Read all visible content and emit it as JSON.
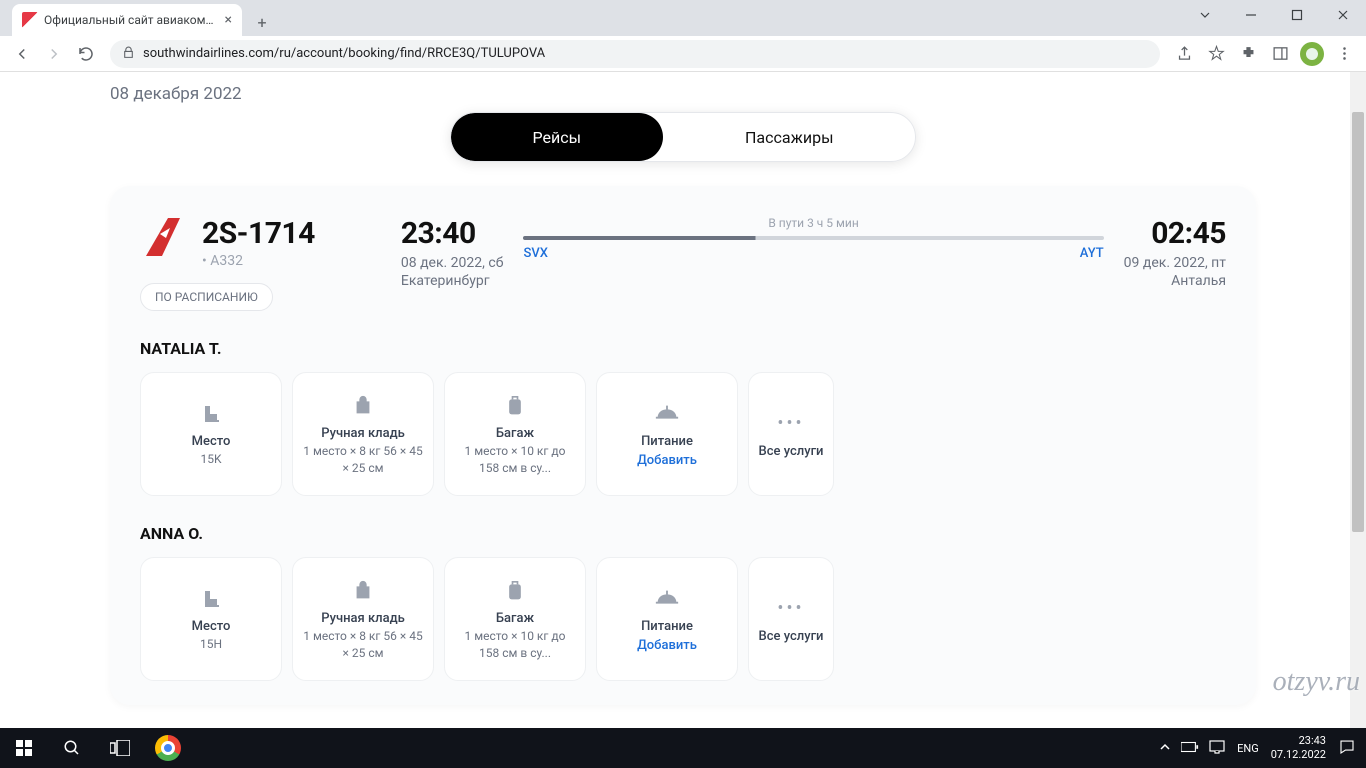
{
  "browser": {
    "tab_title": "Официальный сайт авиакомпан",
    "url": "southwindairlines.com/ru/account/booking/find/RRCE3Q/TULUPOVA"
  },
  "page": {
    "date_sub": "08 декабря 2022",
    "tabs": {
      "flights": "Рейсы",
      "passengers": "Пассажиры"
    }
  },
  "flight": {
    "number": "2S-1714",
    "aircraft": "A332",
    "status": "ПО РАСПИСАНИЮ",
    "duration": "В пути 3 ч 5 мин",
    "dep": {
      "time": "23:40",
      "date": "08 дек. 2022, сб",
      "city": "Екатеринбург",
      "code": "SVX"
    },
    "arr": {
      "time": "02:45",
      "date": "09 дек. 2022, пт",
      "city": "Анталья",
      "code": "AYT"
    }
  },
  "passengers": [
    {
      "name": "NATALIA T.",
      "services": {
        "seat": {
          "title": "Место",
          "detail": "15K"
        },
        "cabin": {
          "title": "Ручная кладь",
          "detail": "1 место × 8 кг 56 × 45 × 25 см"
        },
        "baggage": {
          "title": "Багаж",
          "detail": "1 место × 10 кг до 158 см в су..."
        },
        "meal": {
          "title": "Питание",
          "action": "Добавить"
        },
        "all": {
          "title": "Все услуги"
        }
      }
    },
    {
      "name": "ANNA O.",
      "services": {
        "seat": {
          "title": "Место",
          "detail": "15H"
        },
        "cabin": {
          "title": "Ручная кладь",
          "detail": "1 место × 8 кг 56 × 45 × 25 см"
        },
        "baggage": {
          "title": "Багаж",
          "detail": "1 место × 10 кг до 158 см в су..."
        },
        "meal": {
          "title": "Питание",
          "action": "Добавить"
        },
        "all": {
          "title": "Все услуги"
        }
      }
    }
  ],
  "watermark": "otzyv.ru",
  "taskbar": {
    "lang": "ENG",
    "time": "23:43",
    "date": "07.12.2022"
  }
}
